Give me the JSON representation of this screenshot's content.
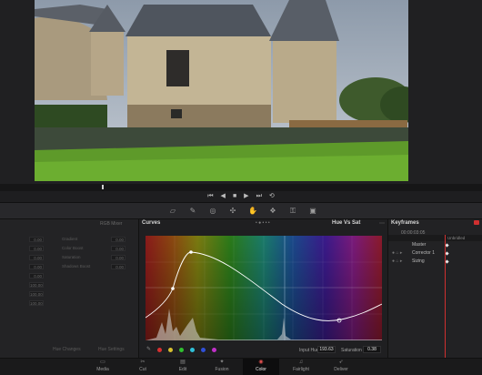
{
  "transport": {
    "buttons": [
      "⏮",
      "◀",
      "■",
      "▶",
      "⏭",
      "⟲"
    ]
  },
  "left_panel": {
    "header": "RGB Mixer",
    "col2_labels": [
      "Gradient",
      "Color Boost",
      "Saturation",
      "Shadows Boost"
    ],
    "col2_values": [
      "0.00",
      "0.00",
      "0.00",
      "0.00"
    ],
    "col1_values": [
      "0.00",
      "0.00",
      "0.00",
      "0.00",
      "0.00",
      "100.00",
      "100.00",
      "100.00"
    ],
    "footer": [
      "Hue Changes",
      "Hue Settings"
    ]
  },
  "curves": {
    "title": "Curves",
    "mode": "Hue Vs Sat",
    "input_hue_label": "Input Hue",
    "input_hue_value": "193.63",
    "saturation_label": "Saturation",
    "saturation_value": "0.38",
    "swatch_colors": [
      "#d83030",
      "#d8c030",
      "#30c030",
      "#30c0d8",
      "#3050d8",
      "#c030c8"
    ]
  },
  "keyframes": {
    "title": "Keyframes",
    "timecode": "00:00:03:05",
    "header_tag": "Unbridled",
    "rows": [
      "Master",
      "Corrector 1",
      "Sizing"
    ]
  },
  "page_nav": {
    "items": [
      {
        "label": "Media",
        "icon": "media-icon"
      },
      {
        "label": "Cut",
        "icon": "cut-icon"
      },
      {
        "label": "Edit",
        "icon": "edit-icon"
      },
      {
        "label": "Fusion",
        "icon": "fusion-icon"
      },
      {
        "label": "Color",
        "icon": "color-icon"
      },
      {
        "label": "Fairlight",
        "icon": "fairlight-icon"
      },
      {
        "label": "Deliver",
        "icon": "deliver-icon"
      }
    ],
    "active": "Color"
  }
}
